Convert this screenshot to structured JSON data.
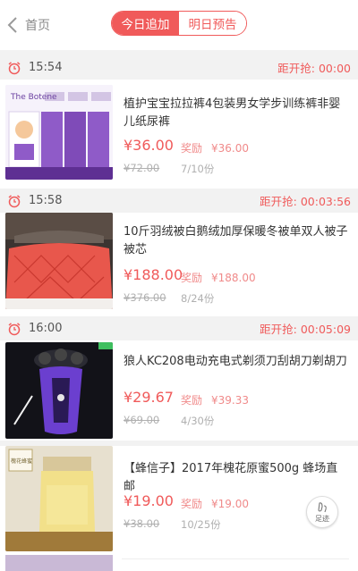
{
  "header": {
    "back_label": "首页",
    "tabs": [
      {
        "label": "今日追加",
        "active": true
      },
      {
        "label": "明日预告",
        "active": false
      }
    ],
    "accent_color": "#f05a5a"
  },
  "countdown_prefix": "距开抢:",
  "reward_label": "奖励",
  "sections": [
    {
      "time": "15:54",
      "countdown": "距开抢: 00:00",
      "item": {
        "title": "植护宝宝拉拉裤4包装男女学步训练裤非婴儿纸尿裤",
        "price": "¥36.00",
        "reward": "¥36.00",
        "original_price": "¥72.00",
        "sold": "7/10份",
        "thumb_text": "The Botene"
      }
    },
    {
      "time": "15:58",
      "countdown": "距开抢: 00:03:56",
      "item": {
        "title": "10斤羽绒被白鹅绒加厚保暖冬被单双人被子被芯",
        "price": "¥188.00",
        "reward": "¥188.00",
        "original_price": "¥376.00",
        "sold": "8/24份"
      }
    },
    {
      "time": "16:00",
      "countdown": "距开抢: 00:05:09",
      "item": {
        "title": "狼人KC208电动充电式剃须刀刮胡刀剃胡刀",
        "price": "¥29.67",
        "reward": "¥39.33",
        "original_price": "¥69.00",
        "sold": "4/30份"
      }
    },
    {
      "time": "",
      "countdown": "",
      "item": {
        "title": "【蜂信子】2017年槐花原蜜500g 蜂场直邮",
        "price": "¥19.00",
        "reward": "¥19.00",
        "original_price": "¥38.00",
        "sold": "10/25份",
        "thumb_text": "槐花蜂蜜"
      }
    }
  ],
  "fab": {
    "label": "足迹",
    "icon": "footprint-icon"
  }
}
